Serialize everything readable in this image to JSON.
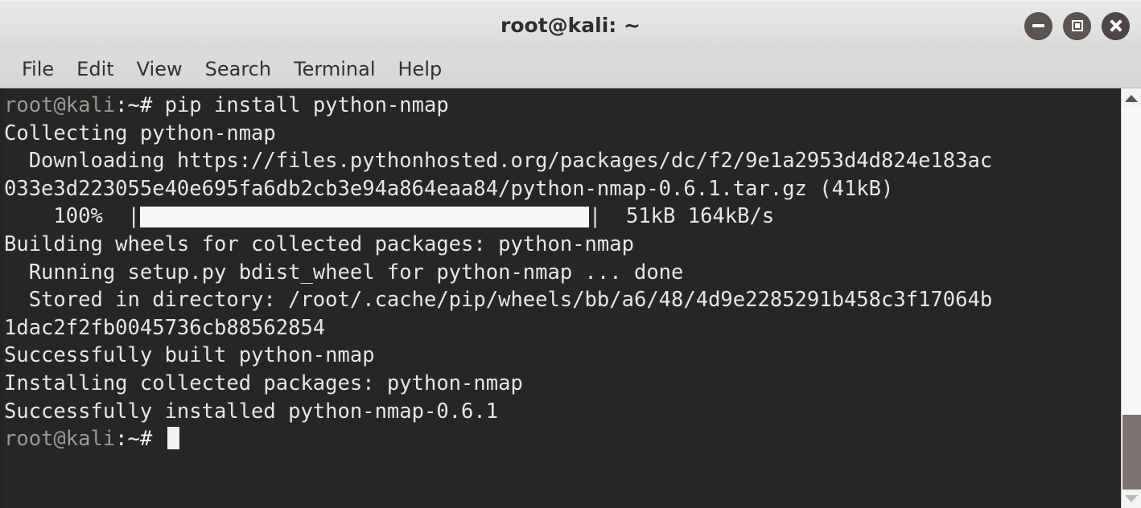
{
  "window": {
    "title": "root@kali: ~",
    "controls": [
      {
        "name": "minimize",
        "label": "Minimize"
      },
      {
        "name": "maximize",
        "label": "Maximize"
      },
      {
        "name": "close",
        "label": "Close"
      }
    ]
  },
  "menubar": {
    "items": [
      {
        "label": "File"
      },
      {
        "label": "Edit"
      },
      {
        "label": "View"
      },
      {
        "label": "Search"
      },
      {
        "label": "Terminal"
      },
      {
        "label": "Help"
      }
    ]
  },
  "terminal": {
    "prompt_user": "root@kali",
    "prompt_symbol": ":~#",
    "command": " pip install python-nmap",
    "lines": [
      "Collecting python-nmap",
      "  Downloading https://files.pythonhosted.org/packages/dc/f2/9e1a2953d4d824e183ac",
      "033e3d223055e40e695fa6db2cb3e94a864eaa84/python-nmap-0.6.1.tar.gz (41kB)"
    ],
    "progress": {
      "percent_label": "    100%  ",
      "left_bracket": "|",
      "right_bracket": "| ",
      "stats": " 51kB 164kB/s",
      "fill_percent": 100
    },
    "lines_after": [
      "Building wheels for collected packages: python-nmap",
      "  Running setup.py bdist_wheel for python-nmap ... done",
      "  Stored in directory: /root/.cache/pip/wheels/bb/a6/48/4d9e2285291b458c3f17064b",
      "1dac2f2fb0045736cb88562854",
      "Successfully built python-nmap",
      "Installing collected packages: python-nmap",
      "Successfully installed python-nmap-0.6.1"
    ],
    "final_prompt_user": "root@kali",
    "final_prompt_symbol": ":~# "
  },
  "scrollbar": {
    "up_arrow": "scroll-up",
    "down_arrow": "scroll-down",
    "thumb": "scroll-thumb"
  },
  "colors": {
    "terminal_bg": "#262626",
    "terminal_fg": "#e6e6e6",
    "prompt_user": "#9e9791",
    "titlebar_bg": "#e2e2e0",
    "progress_fill": "#f7f7f5",
    "scroll_thumb": "#7d7271"
  }
}
